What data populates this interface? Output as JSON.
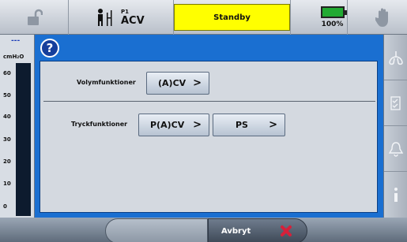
{
  "topbar": {
    "patient_id": "P1",
    "mode": "ACV",
    "status": "Standby",
    "battery_label": "100%",
    "battery_level": 1.0
  },
  "gauge": {
    "indicator": "---",
    "unit": "cmH₂O",
    "ticks": [
      "60",
      "50",
      "40",
      "30",
      "20",
      "10",
      "0"
    ]
  },
  "dialog": {
    "help_glyph": "?",
    "volume_label": "Volymfunktioner",
    "volume_options": [
      "(A)CV"
    ],
    "pressure_label": "Tryckfunktioner",
    "pressure_options": [
      "P(A)CV",
      "PS"
    ],
    "chevron": ">"
  },
  "bottombar": {
    "cancel_label": "Avbryt"
  },
  "colors": {
    "status_yellow": "#ffff00",
    "dialog_blue": "#1a6fd1",
    "battery_green": "#22aa33",
    "cancel_red": "#d6203a"
  },
  "icons": [
    "unlock-icon",
    "patient-icon",
    "battery-icon",
    "hand-icon",
    "lungs-icon",
    "checklist-icon",
    "alarm-bell-icon",
    "info-icon",
    "help-icon",
    "close-icon"
  ]
}
